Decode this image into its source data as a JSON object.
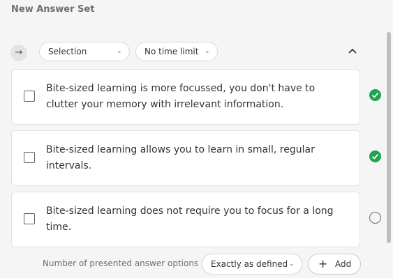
{
  "header": {
    "title": "New Answer Set"
  },
  "toolbar": {
    "nav_icon": "arrow-right-icon",
    "selection_dropdown": {
      "value": "Selection",
      "icon": "chevron-down-icon"
    },
    "time_dropdown": {
      "value": "No time limit",
      "icon": "chevron-down-icon"
    },
    "collapse_icon": "chevron-up-icon"
  },
  "answers": [
    {
      "text": "Bite-sized learning is more focussed, you don't have to clutter your memory with irrelevant information.",
      "checked": false,
      "status": "correct"
    },
    {
      "text": "Bite-sized learning allows you to learn in small, regular intervals.",
      "checked": false,
      "status": "correct"
    },
    {
      "text": "Bite-sized learning does not require you to focus for a long time.",
      "checked": false,
      "status": "incorrect"
    }
  ],
  "footer": {
    "presented_label": "Number of presented answer options",
    "presented_value": "Exactly as defined",
    "add_label": "Add"
  },
  "colors": {
    "correct": "#1fa452",
    "background": "#f5f5f6",
    "card": "#ffffff"
  }
}
